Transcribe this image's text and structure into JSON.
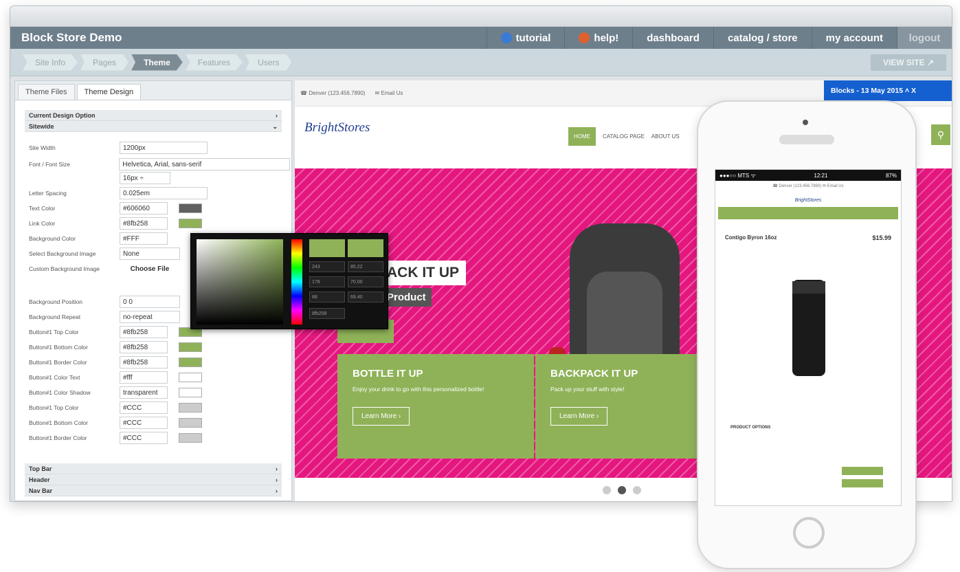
{
  "app": {
    "title": "Block Store Demo"
  },
  "topnav": [
    {
      "label": "tutorial",
      "icon": "globe-icon",
      "color": "#3a7bd5"
    },
    {
      "label": "help!",
      "icon": "lifebuoy-icon",
      "color": "#e06030"
    },
    {
      "label": "dashboard"
    },
    {
      "label": "catalog / store"
    },
    {
      "label": "my account"
    }
  ],
  "logout_label": "logout",
  "steps": [
    {
      "label": "Site Info"
    },
    {
      "label": "Pages"
    },
    {
      "label": "Theme",
      "active": true
    },
    {
      "label": "Features"
    },
    {
      "label": "Users"
    }
  ],
  "view_site": "VIEW SITE ↗",
  "tabs": [
    {
      "label": "Theme Files"
    },
    {
      "label": "Theme Design",
      "active": true
    }
  ],
  "sections": {
    "current": "Current Design Option",
    "sitewide": "Sitewide",
    "topbar": "Top Bar",
    "header": "Header",
    "navbar": "Nav Bar"
  },
  "fields": [
    {
      "label": "Site Width",
      "value": "1200px",
      "w": 128
    },
    {
      "label": "Font / Font Size",
      "value": "Helvetica, Arial, sans-serif",
      "w": 250
    },
    {
      "label": "",
      "value": "16px  ÷",
      "w": 74
    },
    {
      "label": "Letter Spacing",
      "value": "0.025em",
      "w": 128
    },
    {
      "label": "Text Color",
      "value": "#606060",
      "w": 70,
      "swatch": "#606060"
    },
    {
      "label": "Link Color",
      "value": "#8fb258",
      "w": 70,
      "swatch": "#8fb258"
    },
    {
      "label": "Background Color",
      "value": "#FFF",
      "w": 70
    },
    {
      "label": "Select Background Image",
      "value": "None",
      "w": 88
    },
    {
      "label": "Custom Background Image",
      "value": "Choose File",
      "w": 88,
      "button": true
    },
    {
      "label": "Background Position",
      "value": "0 0",
      "w": 88
    },
    {
      "label": "Background Repeat",
      "value": "no-repeat",
      "w": 88
    },
    {
      "label": "Button#1 Top Color",
      "value": "#8fb258",
      "w": 70,
      "swatch": "#8fb258"
    },
    {
      "label": "Button#1 Bottom Color",
      "value": "#8fb258",
      "w": 70,
      "swatch": "#8fb258"
    },
    {
      "label": "Button#1 Border Color",
      "value": "#8fb258",
      "w": 70,
      "swatch": "#8fb258"
    },
    {
      "label": "Button#1 Color Text",
      "value": "#fff",
      "w": 70,
      "swatch": "#ffffff"
    },
    {
      "label": "Button#1 Color Shadow",
      "value": "transparent",
      "w": 70,
      "swatch": "#ffffff"
    },
    {
      "label": "Button#1 Top Color",
      "value": "#CCC",
      "w": 70,
      "swatch": "#cccccc"
    },
    {
      "label": "Button#1 Bottom Color",
      "value": "#CCC",
      "w": 70,
      "swatch": "#cccccc"
    },
    {
      "label": "Button#1 Border Color",
      "value": "#CCC",
      "w": 70,
      "swatch": "#cccccc"
    }
  ],
  "picker": {
    "hex": "8fb258",
    "vals": [
      "243",
      "85.22",
      "178",
      "70.00",
      "88",
      "69.40"
    ]
  },
  "preview": {
    "phone": "☎ Denver (123.456.7890)",
    "email": "✉ Email Us",
    "blocks": "Blocks - 13 May 2015   ˄  X",
    "logo": "BrightStores",
    "nav": [
      "HOME",
      "CATALOG PAGE",
      "ABOUT US"
    ],
    "hero_title": "ACK IT UP",
    "hero_sub": "Product",
    "cards": [
      {
        "title": "BOTTLE IT UP",
        "text": "Enjoy your drink to go with this personalized bottle!",
        "btn": "Learn More ›"
      },
      {
        "title": "BACKPACK IT UP",
        "text": "Pack up your stuff with style!",
        "btn": "Learn More ›"
      }
    ]
  },
  "mobile": {
    "carrier": "●●●○○ MTS ᯤ",
    "time": "12:21",
    "battery": "87%",
    "product": "Contigo Byron 16oz",
    "price": "$15.99",
    "opts": "PRODUCT OPTIONS",
    "logo": "BrightStores"
  },
  "colors": {
    "accent": "#8fb258",
    "hero": "#e4177f",
    "topbar": "#6e7f8c",
    "blocks": "#1560d0"
  }
}
